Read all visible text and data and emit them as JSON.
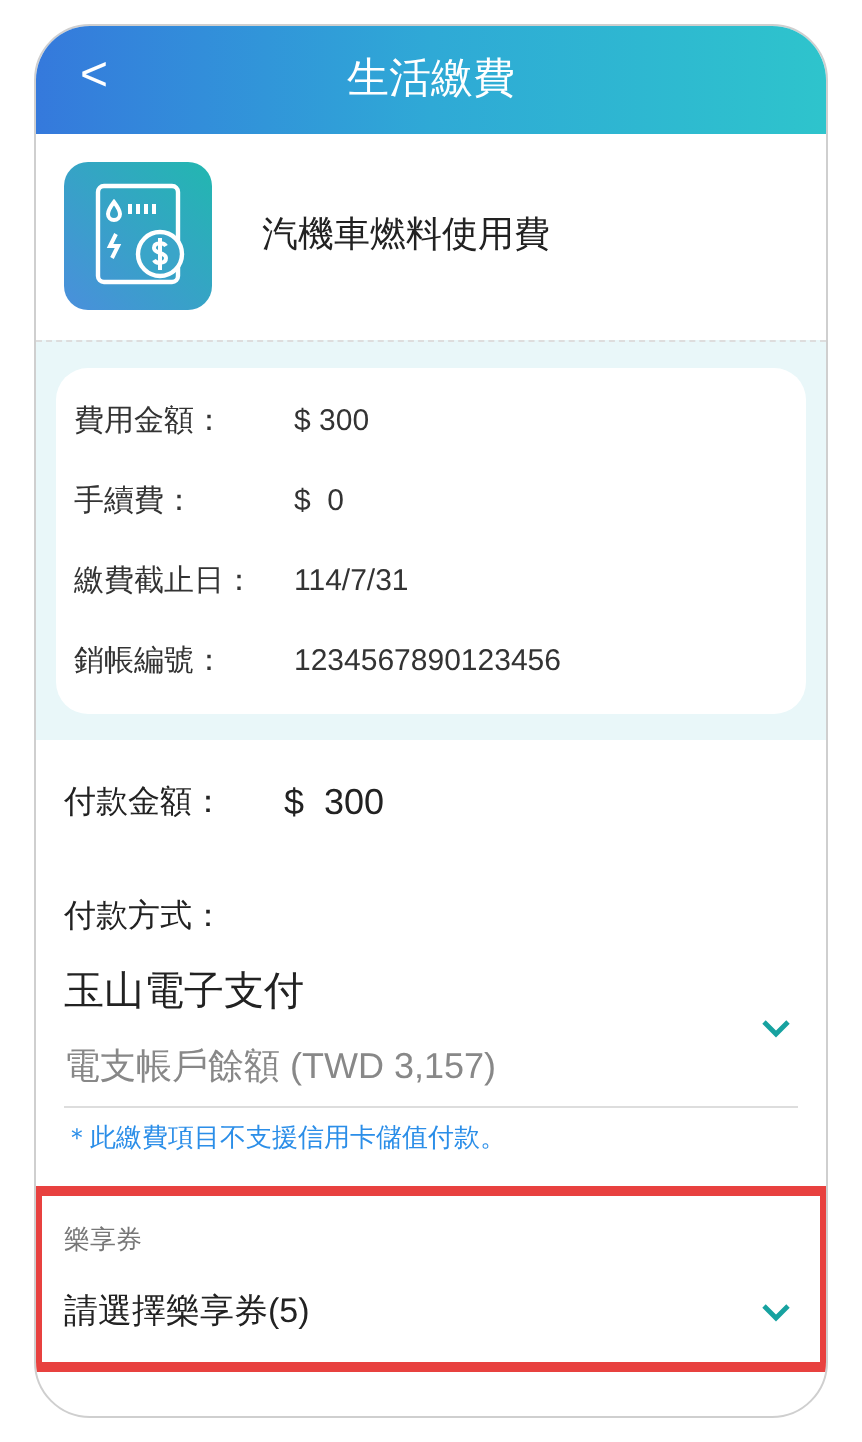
{
  "header": {
    "back": "<",
    "title": "生活繳費"
  },
  "biller": {
    "name": "汽機車燃料使用費"
  },
  "details": [
    {
      "label": "費用金額：",
      "value": "$ 300"
    },
    {
      "label": "手續費：",
      "value": "$  0"
    },
    {
      "label": "繳費截止日：",
      "value": "114/7/31"
    },
    {
      "label": "銷帳編號：",
      "value": "1234567890123456"
    }
  ],
  "payment_amount": {
    "label": "付款金額：",
    "currency": "$",
    "value": "300"
  },
  "payment_method": {
    "label": "付款方式：",
    "value": "玉山電子支付",
    "balance": "電支帳戶餘額 (TWD 3,157)",
    "note": "＊此繳費項目不支援信用卡儲值付款。"
  },
  "coupon": {
    "label": "樂享券",
    "value": "請選擇樂享券(5)",
    "highlighted": true
  }
}
